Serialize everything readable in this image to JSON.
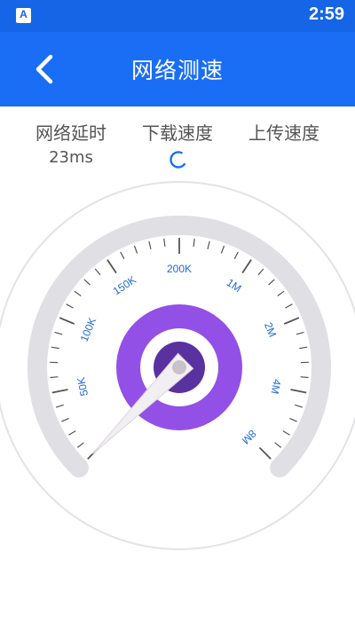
{
  "status_bar": {
    "app_icon_letter": "A",
    "time": "2:59"
  },
  "app_bar": {
    "title": "网络测速",
    "back_icon": "chevron-left-icon"
  },
  "stats": {
    "latency_label": "网络延时",
    "latency_value": "23ms",
    "download_label": "下载速度",
    "download_icon": "loading-spinner-icon",
    "upload_label": "上传速度"
  },
  "gauge": {
    "scale_labels": [
      "50K",
      "100K",
      "150K",
      "200K",
      "1M",
      "2M",
      "4M",
      "8M"
    ],
    "needle_position": 0.0
  },
  "colors": {
    "primary": "#1a6ef5",
    "status_bar": "#1565e6",
    "gauge_track": "#e0dfe3",
    "tick_label": "#1e6ad8",
    "ring_outer": "#9350e6",
    "ring_inner": "#5a32a0"
  }
}
